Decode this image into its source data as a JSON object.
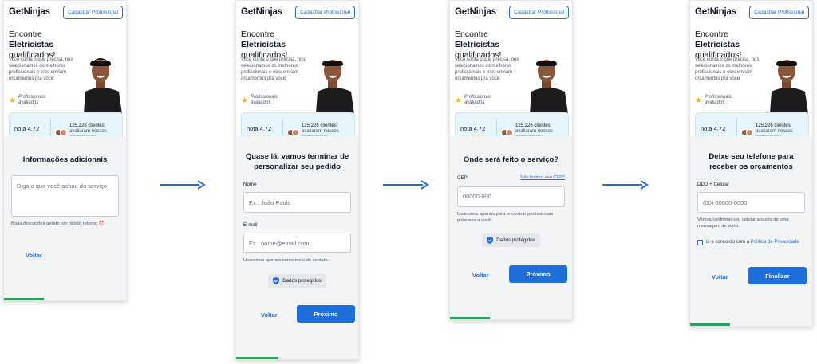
{
  "header": {
    "logo": "GetNinjas",
    "cta": "Cadastrar Profissional"
  },
  "hero": {
    "headline_pre": "Encontre ",
    "headline_bold": "Eletricistas",
    "headline_post": "qualificados!",
    "subtext": "Você conta o que precisa, nós selecionamos os melhores profissionais e eles enviam orçamentos pra você.",
    "rated_label": "Profissionais avaliados",
    "score": "nota 4.72",
    "stars": "★★★★★",
    "clients_count": "125.226 clientes",
    "clients_text": "avaliaram nossos profissionais"
  },
  "steps": [
    {
      "title": "Informações adicionais",
      "placeholder": "Diga o que você achou do serviço",
      "hint": "Boas descrições geram um rápido retorno ⏰",
      "back": "Voltar",
      "progress": 0.33
    },
    {
      "title": "Quase lá, vamos terminar de personalizar seu pedido",
      "name_label": "Nome",
      "name_placeholder": "Ex.: João Paulo",
      "email_label": "E-mail",
      "email_placeholder": "Ex.: nome@email.com",
      "email_hint": "Usaremos apenas como meio de contato.",
      "badge": "Dados protegidos",
      "back": "Voltar",
      "next": "Próximo",
      "progress": 0.33
    },
    {
      "title": "Onde será feito o serviço?",
      "cep_label": "CEP",
      "cep_link": "Não lembra seu CEP?",
      "cep_placeholder": "00000-000",
      "cep_hint": "Usaremos apenas para encontrar profissionais próximos a você.",
      "badge": "Dados protegidos",
      "back": "Voltar",
      "next": "Próximo",
      "progress": 0.33
    },
    {
      "title": "Deixe seu telefone para receber os orçamentos",
      "phone_label": "DDD + Celular",
      "phone_placeholder": "(00) 00000-0000",
      "phone_hint": "Vamos confirmar seu celular através de uma mensagem de texto.",
      "agree_text": "Li e concordo com a ",
      "agree_link": "Política de Privacidade",
      "back": "Voltar",
      "finish": "Finalizar",
      "progress": 0.33
    }
  ],
  "colors": {
    "accent": "#1e6fd9",
    "progress": "#2e9e5f",
    "card": "#e6f4fb",
    "star": "#f5b400"
  }
}
